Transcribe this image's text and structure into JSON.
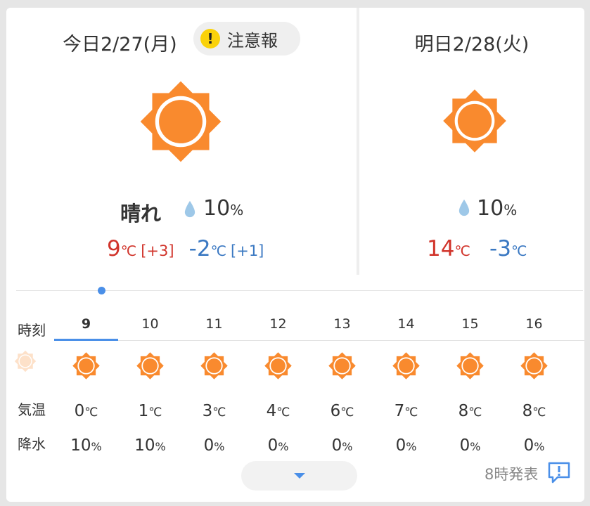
{
  "today": {
    "date": "今日2/27(月)",
    "alert_label": "注意報",
    "alert_icon_glyph": "!",
    "condition": "晴れ",
    "precip_value": "10",
    "precip_unit": "%",
    "high": "9",
    "high_unit": "℃",
    "high_diff": "[+3]",
    "low": "-2",
    "low_unit": "℃",
    "low_diff": "[+1]",
    "icon": "sunny-icon"
  },
  "tomorrow": {
    "date": "明日2/28(火)",
    "precip_value": "10",
    "precip_unit": "%",
    "high": "14",
    "high_unit": "℃",
    "low": "-3",
    "low_unit": "℃",
    "icon": "sunny-icon"
  },
  "hourly": {
    "labels": {
      "time": "時刻",
      "temp": "気温",
      "precip": "降水"
    },
    "hours": [
      {
        "hour": "9",
        "temp": "0",
        "temp_unit": "℃",
        "precip": "10",
        "precip_unit": "%"
      },
      {
        "hour": "10",
        "temp": "1",
        "temp_unit": "℃",
        "precip": "10",
        "precip_unit": "%"
      },
      {
        "hour": "11",
        "temp": "3",
        "temp_unit": "℃",
        "precip": "0",
        "precip_unit": "%"
      },
      {
        "hour": "12",
        "temp": "4",
        "temp_unit": "℃",
        "precip": "0",
        "precip_unit": "%"
      },
      {
        "hour": "13",
        "temp": "6",
        "temp_unit": "℃",
        "precip": "0",
        "precip_unit": "%"
      },
      {
        "hour": "14",
        "temp": "7",
        "temp_unit": "℃",
        "precip": "0",
        "precip_unit": "%"
      },
      {
        "hour": "15",
        "temp": "8",
        "temp_unit": "℃",
        "precip": "0",
        "precip_unit": "%"
      },
      {
        "hour": "16",
        "temp": "8",
        "temp_unit": "℃",
        "precip": "0",
        "precip_unit": "%"
      }
    ],
    "active_hour": "9"
  },
  "footer": {
    "issued": "8時発表",
    "expand_icon": "chevron-down-icon",
    "feedback_icon": "feedback-icon"
  },
  "colors": {
    "sun": "#f98a2e",
    "high": "#d1342b",
    "low": "#3a78c2",
    "accent": "#4a8fe8",
    "alert": "#fad20a",
    "drop": "#9ec8e8"
  }
}
